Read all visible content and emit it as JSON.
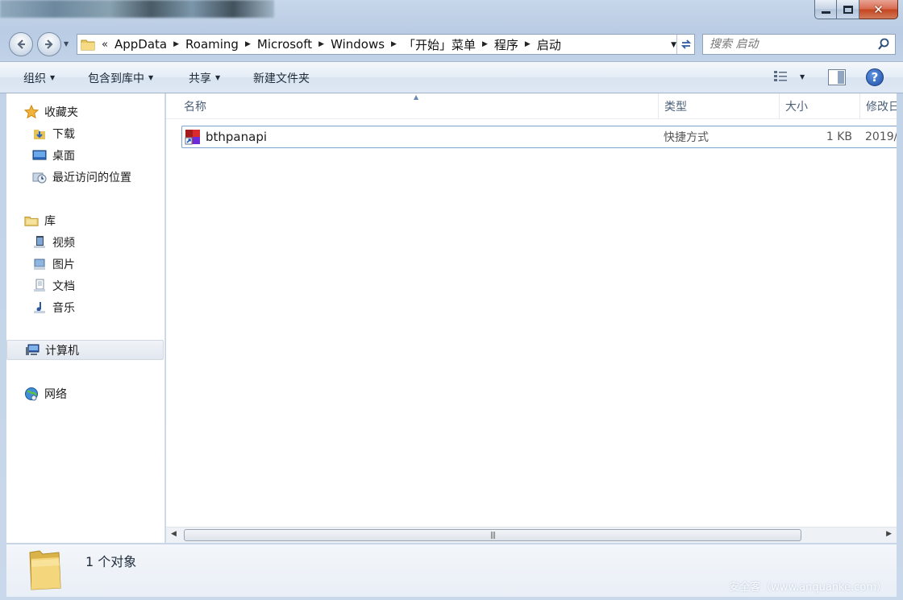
{
  "window": {
    "controls": {
      "minimize_icon": "minimize-icon",
      "maximize_icon": "maximize-icon",
      "close_glyph": "✕"
    }
  },
  "nav": {
    "path_prefix": "«",
    "breadcrumbs": [
      "AppData",
      "Roaming",
      "Microsoft",
      "Windows",
      "「开始」菜单",
      "程序",
      "启动"
    ],
    "search_placeholder": "搜索 启动"
  },
  "toolbar": {
    "organize": "组织",
    "include_in_library": "包含到库中",
    "share": "共享",
    "new_folder": "新建文件夹",
    "help_glyph": "?"
  },
  "sidebar": {
    "favorites": {
      "label": "收藏夹",
      "items": [
        "下载",
        "桌面",
        "最近访问的位置"
      ]
    },
    "libraries": {
      "label": "库",
      "items": [
        "视频",
        "图片",
        "文档",
        "音乐"
      ]
    },
    "computer": "计算机",
    "network": "网络"
  },
  "columns": {
    "name": "名称",
    "type": "类型",
    "size": "大小",
    "modified": "修改日"
  },
  "files": [
    {
      "name": "bthpanapi",
      "type": "快捷方式",
      "size": "1 KB",
      "modified": "2019/"
    }
  ],
  "status": {
    "count": "1 个对象"
  },
  "watermark": "安全客（www.anquanke.com）",
  "colors": {
    "selection_border": "#7da2ce",
    "header_text": "#4c607a",
    "chrome": "#c9d8ea"
  }
}
